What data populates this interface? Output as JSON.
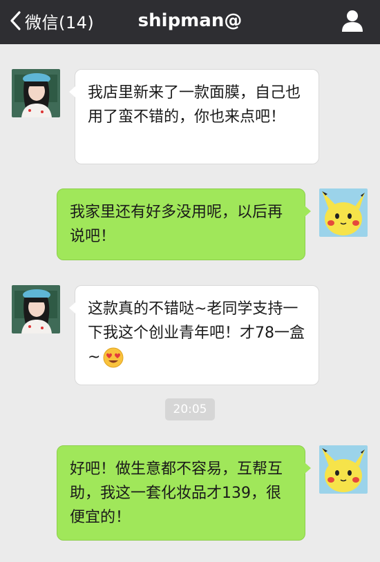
{
  "header": {
    "back_label": "微信(14)",
    "title": "shipman@"
  },
  "messages": [
    {
      "side": "left",
      "text": "我店里新来了一款面膜，自己也用了蛮不错的，你也来点吧！"
    },
    {
      "side": "right",
      "text": "我家里还有好多没用呢，以后再说吧！"
    },
    {
      "side": "left",
      "text": "这款真的不错哒~老同学支持一下我这个创业青年吧！才78一盒~",
      "emoji": "smiling-face-with-heart-eyes"
    },
    {
      "side": "right",
      "text": "好吧！做生意都不容易，互帮互助，我这一套化妆品才139，很便宜的！"
    }
  ],
  "timestamp": "20:05",
  "colors": {
    "topbar": "#2e2e32",
    "background": "#ebebeb",
    "sent_bubble": "#a0e75a",
    "received_bubble": "#ffffff"
  }
}
